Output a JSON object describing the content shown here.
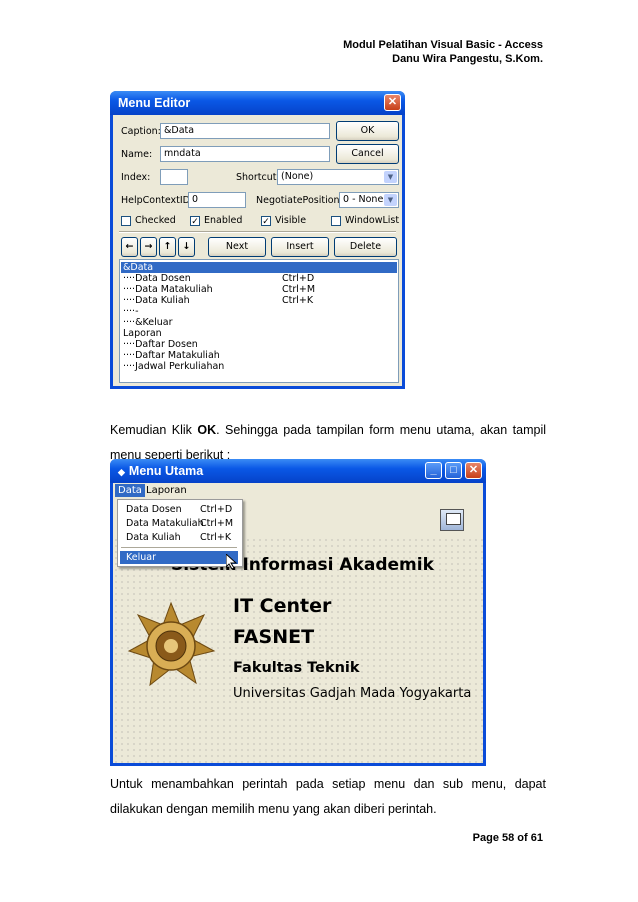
{
  "header": {
    "line1": "Modul Pelatihan Visual Basic - Access",
    "line2": "Danu Wira Pangestu, S.Kom."
  },
  "menu_editor": {
    "title": "Menu Editor",
    "caption_label": "Caption:",
    "caption_value": "&Data",
    "name_label": "Name:",
    "name_value": "mndata",
    "index_label": "Index:",
    "index_value": "",
    "shortcut_label": "Shortcut:",
    "shortcut_value": "(None)",
    "helpcontext_label": "HelpContextID:",
    "helpcontext_value": "0",
    "negotiate_label": "NegotiatePosition:",
    "negotiate_value": "0 - None",
    "ok_label": "OK",
    "cancel_label": "Cancel",
    "checked_label": "Checked",
    "enabled_label": "Enabled",
    "visible_label": "Visible",
    "windowlist_label": "WindowList",
    "checked": false,
    "enabled": true,
    "visible": true,
    "windowlist": false,
    "next_label": "Next",
    "insert_label": "Insert",
    "delete_label": "Delete",
    "arrows": [
      "←",
      "→",
      "↑",
      "↓"
    ],
    "items": [
      {
        "text": "&Data",
        "shortcut": "",
        "selected": true
      },
      {
        "text": "····Data Dosen",
        "shortcut": "Ctrl+D"
      },
      {
        "text": "····Data Matakuliah",
        "shortcut": "Ctrl+M"
      },
      {
        "text": "····Data Kuliah",
        "shortcut": "Ctrl+K"
      },
      {
        "text": "····-",
        "shortcut": ""
      },
      {
        "text": "····&Keluar",
        "shortcut": ""
      },
      {
        "text": "Laporan",
        "shortcut": ""
      },
      {
        "text": "····Daftar Dosen",
        "shortcut": ""
      },
      {
        "text": "····Daftar Matakuliah",
        "shortcut": ""
      },
      {
        "text": "····Jadwal Perkuliahan",
        "shortcut": ""
      }
    ]
  },
  "para1": {
    "before": "Kemudian Klik ",
    "bold": "OK",
    "after": ". Sehingga pada tampilan form menu utama, akan tampil menu seperti berikut :"
  },
  "menu_utama": {
    "title": "Menu Utama",
    "menus": [
      "Data",
      "Laporan"
    ],
    "dropdown": [
      {
        "label": "Data Dosen",
        "shortcut": "Ctrl+D"
      },
      {
        "label": "Data Matakuliah",
        "shortcut": "Ctrl+M"
      },
      {
        "label": "Data Kuliah",
        "shortcut": "Ctrl+K"
      }
    ],
    "keluar_label": "Keluar",
    "heading": "Sistem Informasi Akademik",
    "line1": "IT Center",
    "line2": "FASNET",
    "line3": "Fakultas Teknik",
    "line4": "Universitas Gadjah Mada Yogyakarta"
  },
  "para2": "Untuk menambahkan perintah pada setiap menu dan sub menu, dapat dilakukan dengan memilih menu yang akan diberi perintah.",
  "footer": "Page 58 of 61"
}
